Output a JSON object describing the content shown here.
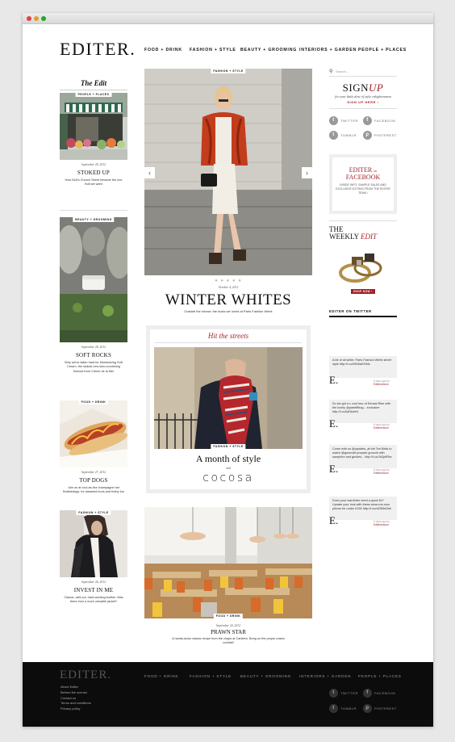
{
  "brand": {
    "logo": "EDITER."
  },
  "nav": [
    "FOOD + DRINK",
    "FASHION + STYLE",
    "BEAUTY + GROOMING",
    "INTERIORS + GARDEN",
    "PEOPLE + PLACES"
  ],
  "left": {
    "heading": "The Edit",
    "cards": [
      {
        "tag": "PEOPLE + PLACES",
        "date": "September 28, 2012",
        "title": "STOKED UP",
        "desc": "How N16's Church Street became the one that we want"
      },
      {
        "tag": "BEAUTY + GROOMING",
        "date": "September 28, 2012",
        "title": "SOFT ROCKS",
        "desc": "Why we've fallen hard for Moisturizing Soft Cream, the radical new skin-nourishing formula from Crème de la Mer"
      },
      {
        "tag": "FOOD + DRINK",
        "date": "September 27, 2012",
        "title": "TOP DOGS",
        "desc": "Join us at cool-as-fizz champagne bar Bubbledogs, for steamed buns and frothy fun"
      },
      {
        "tag": "FASHION + STYLE",
        "date": "September 26, 2012",
        "title": "INVEST IN ME",
        "desc": "Classic, well-cut, hard-working leather. Was there ever a more versatile jacket?"
      }
    ]
  },
  "hero": {
    "tag": "FASHION + STYLE",
    "prev": "‹",
    "next": "›",
    "pager": "● ● ● ● ●",
    "date": "October 4, 2012",
    "title": "WINTER WHITES",
    "subtitle": "Outside the shows: the looks we loved at Paris Fashion Week"
  },
  "promo": {
    "heading": "Hit the streets",
    "tag": "FASHION + STYLE",
    "title": "A month of style",
    "with": "with",
    "partner": "cocosa"
  },
  "feature": {
    "tag": "FOOD + DRINK",
    "date": "September 24, 2012",
    "title": "PRAWN STAR",
    "desc": "A hands-down classic recipe from the chaps at Canteen. Bring on the proper prawn cocktail!"
  },
  "sidebar": {
    "search_placeholder": "Search...",
    "signup": {
      "title_a": "SIGN",
      "title_b": "UP",
      "line": "for your daily dose of style enlightenment",
      "cta": "SIGN UP HERE ›"
    },
    "social": [
      {
        "icon": "twitter-icon",
        "glyph": "t",
        "label": "TWITTER"
      },
      {
        "icon": "facebook-icon",
        "glyph": "f",
        "label": "FACEBOOK"
      },
      {
        "icon": "tumblr-icon",
        "glyph": "t",
        "label": "TUMBLR"
      },
      {
        "icon": "pinterest-icon",
        "glyph": "p",
        "label": "PINTEREST"
      }
    ],
    "facebook": {
      "line1": "EDITER",
      "on": "on",
      "line2": "FACEBOOK",
      "desc": "INSIDE INFO, SAMPLE SALES AND EXCLUSIVE EXTRAS FROM THE EDITER TEAM ›"
    },
    "weekly": {
      "line1": "THE",
      "line2a": "WEEKLY ",
      "line2b": "EDIT",
      "shop": "SHOP NOW ›"
    },
    "twitter_heading": "EDITER ON TWITTER",
    "tweets": [
      {
        "text": "A bit of all white: Paris Fashion Week street style http://t.co/9tG6aDGMz",
        "time": "5 days ago by",
        "handle": "Editerdotcom"
      },
      {
        "text": "So we got a v cool tour of Kensal Rise with the lovely @parkfifblog... exclusive http://t.co/lqFAoleN",
        "time": "6 days ago by",
        "handle": "Editerdotcom"
      },
      {
        "text": "Come with us @upstairs_at the Ten Bells to watch @gorsovitt prepare grouchi with samphire and girolles... http://t.co/JhZpflRra",
        "time": "8 days ago by",
        "handle": "Editerdotcom"
      },
      {
        "text": "Does your wardrobe need a quick fix? Update your look with these wear-me-now pieces for under £150 http://t.co/d2SMxDeh",
        "time": "9 days ago by",
        "handle": "Editerdotcom"
      }
    ],
    "mark": "E."
  },
  "footer": {
    "logo": "EDITER.",
    "nav": [
      "FOOD + DRINK",
      "FASHION + STYLE",
      "BEAUTY + GROOMING",
      "INTERIORS + GARDEN",
      "PEOPLE + PLACES"
    ],
    "links": [
      "About Editer",
      "Behind the scenes",
      "Contact us",
      "Terms and conditions",
      "Privacy policy"
    ],
    "social": [
      {
        "icon": "twitter-icon",
        "glyph": "t",
        "label": "TWITTER"
      },
      {
        "icon": "facebook-icon",
        "glyph": "f",
        "label": "FACEBOOK"
      },
      {
        "icon": "tumblr-icon",
        "glyph": "t",
        "label": "TUMBLR"
      },
      {
        "icon": "pinterest-icon",
        "glyph": "p",
        "label": "PINTEREST"
      }
    ]
  }
}
